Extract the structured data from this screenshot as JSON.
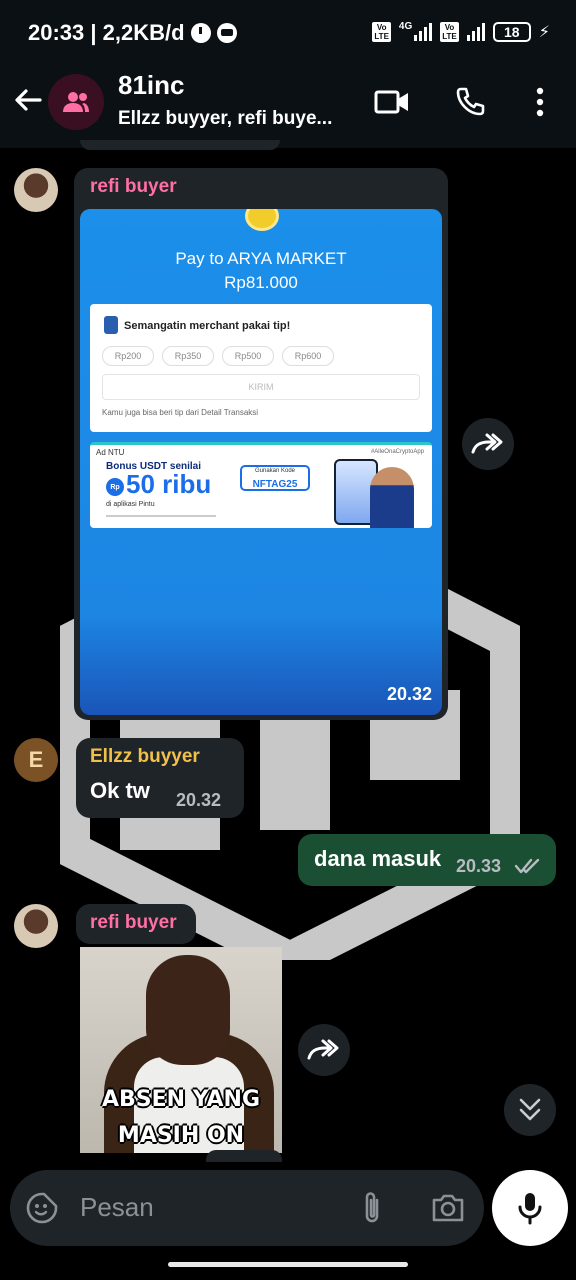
{
  "status_bar": {
    "time_speed": "20:33 | 2,2KB/d",
    "volte_1": "Vo\nLTE",
    "network_type": "4G",
    "volte_2": "Vo\nLTE",
    "battery": "18"
  },
  "header": {
    "title": "81inc",
    "subtitle": "Ellzz buyyer, refi buye..."
  },
  "messages": {
    "m1": {
      "sender": "refi buyer",
      "time": "20.32",
      "screenshot": {
        "pay_title": "Pay to ARYA MARKET",
        "pay_amount": "Rp81.000",
        "tip_heading": "Semangatin merchant pakai tip!",
        "chips": [
          "Rp200",
          "Rp350",
          "Rp500",
          "Rp600"
        ],
        "send_button": "KIRIM",
        "tip_note": "Kamu juga bisa beri tip dari Detail Transaksi",
        "ad_brand": "Ad NTU",
        "ad_tag": "#AlleOnaCryptoApp",
        "ad_title": "Bonus USDT senilai",
        "ad_rp": "Rp",
        "ad_big": "50 ribu",
        "ad_sub": "di aplikasi Pintu",
        "ad_code_label": "Gunakan Kode",
        "ad_code": "NFTAG25"
      }
    },
    "m2": {
      "sender": "Ellzz buyyer",
      "avatar_letter": "E",
      "text": "Ok tw",
      "time": "20.32"
    },
    "m3": {
      "text": "dana masuk",
      "time": "20.33"
    },
    "m4": {
      "sender": "refi buyer",
      "meme_line1": "ABSEN YANG",
      "meme_line2": "MASIH ON"
    }
  },
  "input": {
    "placeholder": "Pesan"
  },
  "colors": {
    "header_bg": "#0b1014",
    "bubble_in": "#1f2428",
    "bubble_out": "#1a4f34",
    "sender_pink": "#ff6fa4",
    "sender_gold": "#f0c04a"
  },
  "icons": [
    "arrow-left-icon",
    "group-icon",
    "video-call-icon",
    "phone-icon",
    "more-vert-icon",
    "forward-icon",
    "sticker-icon",
    "attach-icon",
    "camera-icon",
    "mic-icon",
    "double-chevron-down-icon",
    "double-check-icon"
  ]
}
